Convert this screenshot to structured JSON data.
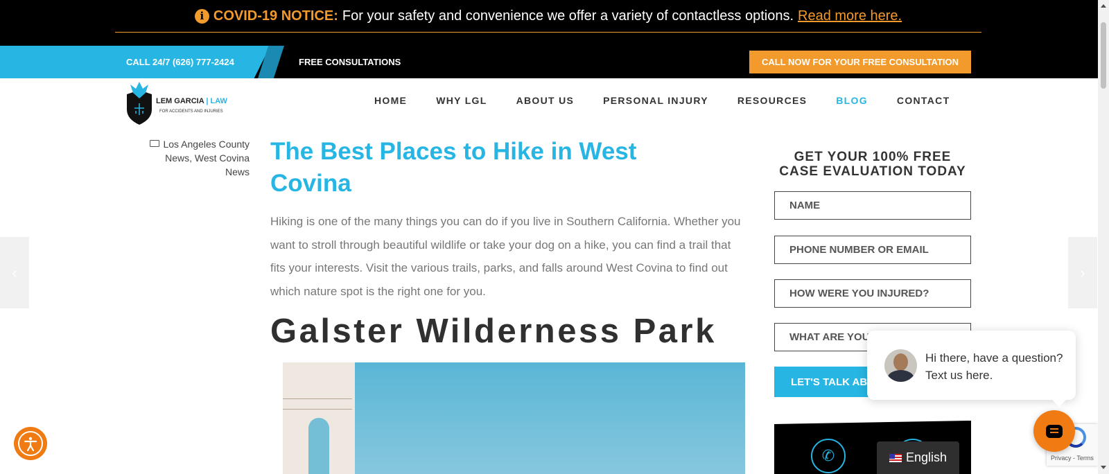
{
  "covid": {
    "icon": "info-icon",
    "label": "COVID-19 NOTICE:",
    "message": "For your safety and convenience we offer a variety of contactless options.",
    "link": "Read more here."
  },
  "topbar": {
    "call": "CALL 24/7 (626) 777-2424",
    "free": "FREE CONSULTATIONS",
    "cta": "CALL NOW FOR YOUR FREE CONSULTATION"
  },
  "logo": {
    "name": "LEM GARCIA",
    "divider": " | ",
    "law": "LAW",
    "tagline": "FOR ACCIDENTS AND INJURIES"
  },
  "nav": [
    "HOME",
    "WHY LGL",
    "ABOUT US",
    "PERSONAL INJURY",
    "RESOURCES",
    "BLOG",
    "CONTACT"
  ],
  "nav_active": "BLOG",
  "categories": {
    "icon": "folder-icon",
    "text": "Los Angeles County News, West Covina News"
  },
  "article": {
    "title": "The Best Places to Hike in West Covina",
    "intro": "Hiking is one of the many things you can do if you live in Southern California. Whether you want to stroll through beautiful wildlife or take your dog on a hike, you can find a trail that fits your interests. Visit the various trails, parks, and falls around West Covina to find out which nature spot is the right one for you.",
    "h2": "Galster Wilderness Park"
  },
  "form": {
    "heading": "GET YOUR 100% FREE CASE EVALUATION TODAY",
    "name": "NAME",
    "contact": "PHONE NUMBER OR EMAIL",
    "injury": "HOW WERE YOU INJURED?",
    "partial": "WHAT ARE YOU",
    "submit": "LET'S TALK AB"
  },
  "chat": {
    "message": "Hi there, have a question? Text us here."
  },
  "language": {
    "label": "English"
  },
  "recaptcha": {
    "text": "Privacy - Terms"
  },
  "colors": {
    "accent": "#27b5e3",
    "orange": "#f39a2c",
    "dark": "#000000"
  }
}
